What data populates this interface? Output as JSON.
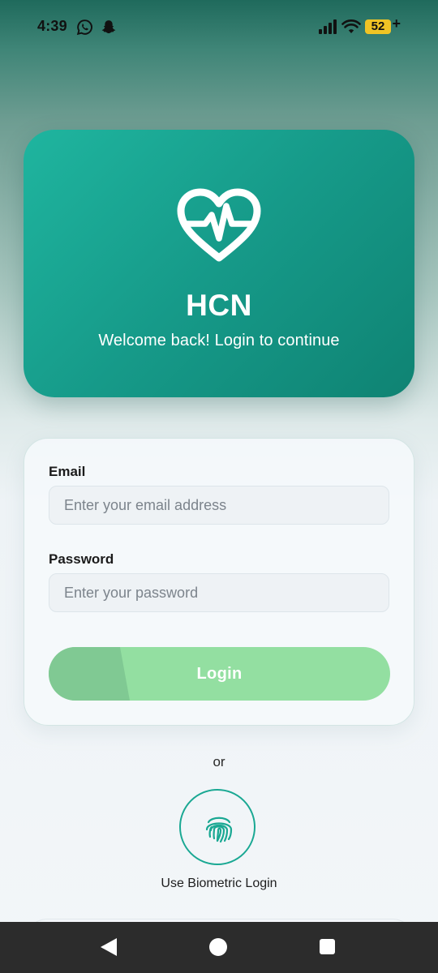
{
  "status_bar": {
    "time": "4:39",
    "battery": "52",
    "battery_suffix": "+",
    "icons": [
      "whatsapp-icon",
      "snapchat-icon",
      "signal-icon",
      "wifi-icon",
      "battery-icon"
    ]
  },
  "hero": {
    "icon": "heart-pulse-icon",
    "title": "HCN",
    "subtitle": "Welcome back! Login to continue"
  },
  "form": {
    "email_label": "Email",
    "email_placeholder": "Enter your email address",
    "email_value": "",
    "password_label": "Password",
    "password_placeholder": "Enter your password",
    "password_value": "",
    "login_label": "Login"
  },
  "alt": {
    "or_text": "or",
    "biometric_icon": "fingerprint-icon",
    "biometric_label": "Use Biometric Login"
  },
  "nav": {
    "icons": [
      "back-icon",
      "home-icon",
      "recents-icon"
    ]
  },
  "colors": {
    "accent": "#1aa893",
    "hero_start": "#1fb59f",
    "hero_end": "#0f8373",
    "login_button": "#93dfa1",
    "nav_bar": "#2c2c2c"
  }
}
